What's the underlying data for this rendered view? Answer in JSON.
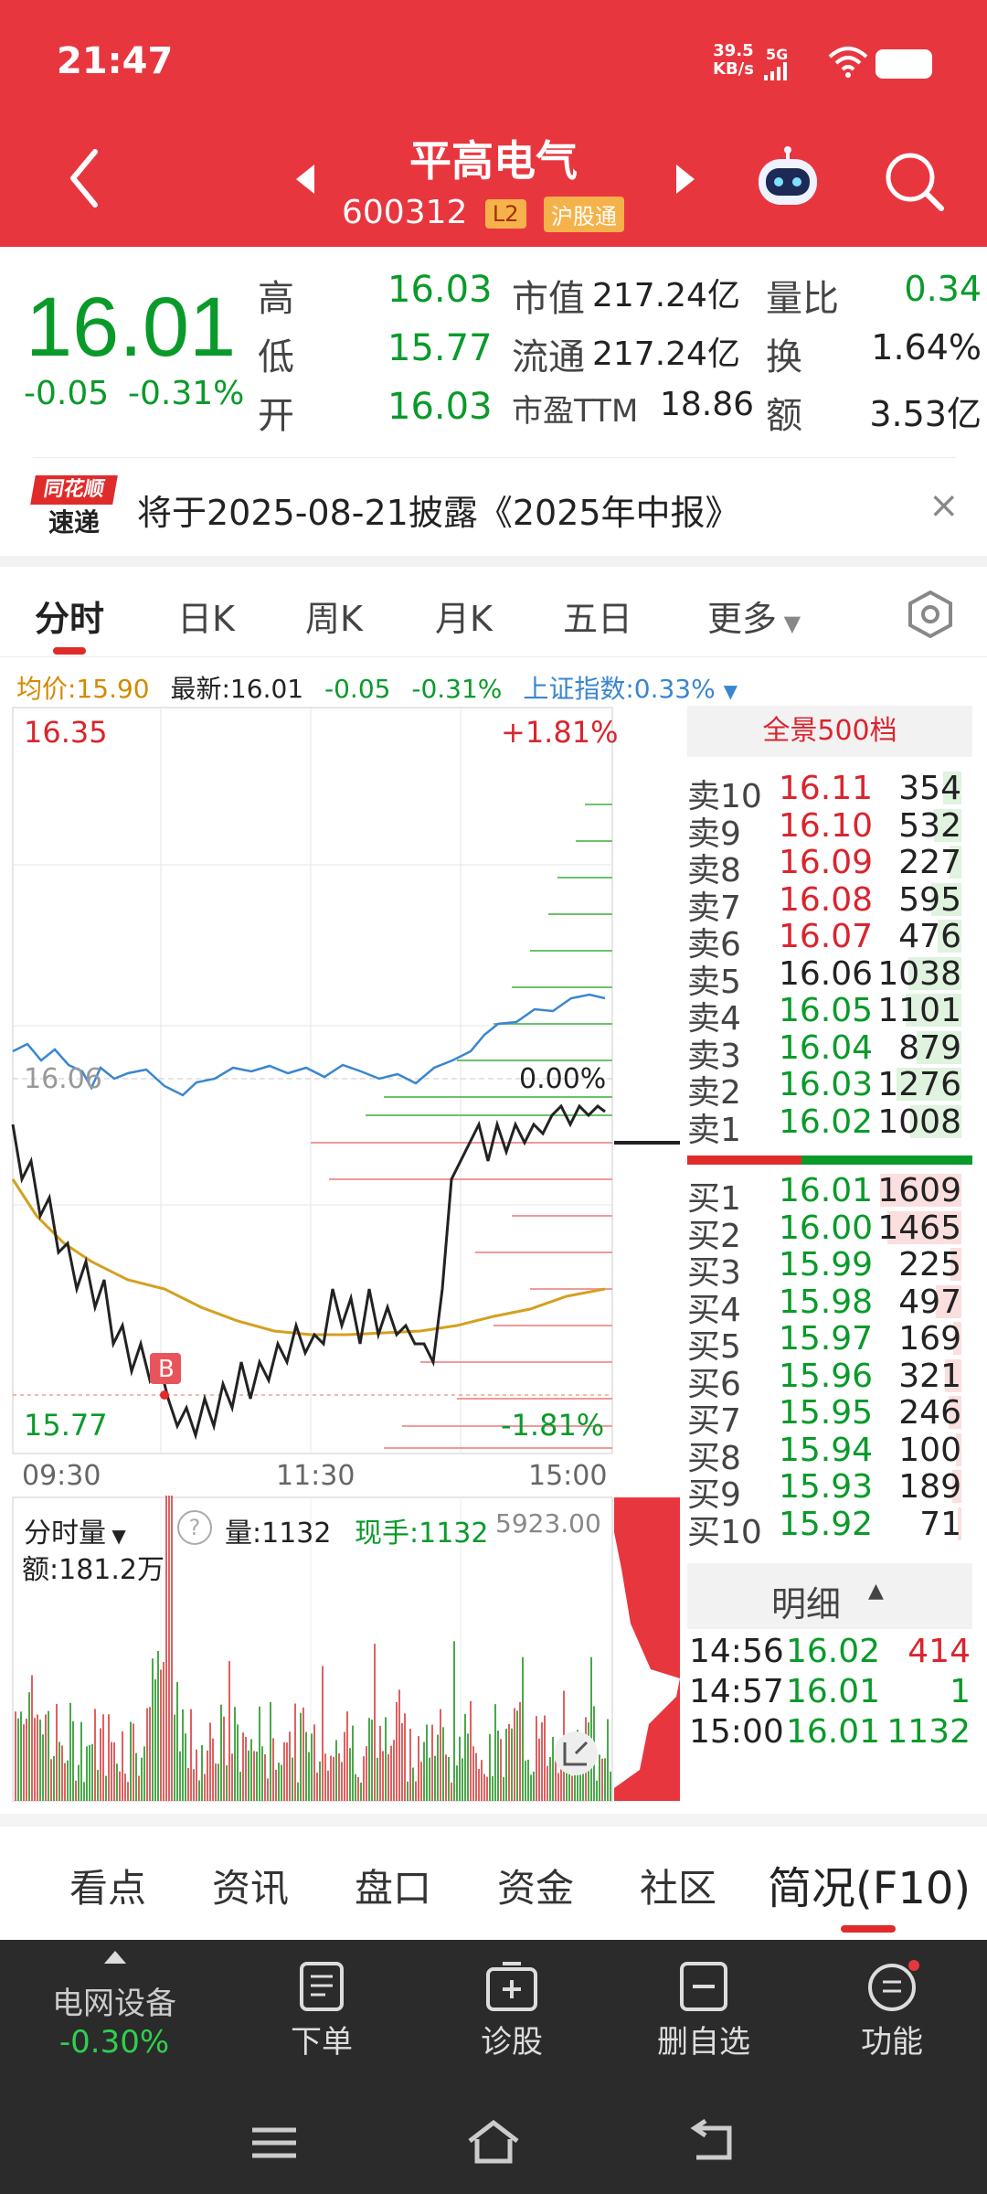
{
  "status_bar": {
    "time": "21:47",
    "net_speed": "39.5",
    "net_unit": "KB/s",
    "signal": "5G"
  },
  "header": {
    "name": "平高电气",
    "code": "600312",
    "tag_l2": "L2",
    "tag_connect": "沪股通"
  },
  "quote": {
    "price": "16.01",
    "change": "-0.05",
    "change_pct": "-0.31%",
    "high_label": "高",
    "high": "16.03",
    "low_label": "低",
    "low": "15.77",
    "open_label": "开",
    "open": "16.03",
    "mktcap_label": "市值",
    "mktcap": "217.24亿",
    "float_label": "流通",
    "float": "217.24亿",
    "pe_label": "市盈TTM",
    "pe": "18.86",
    "volratio_label": "量比",
    "volratio": "0.34",
    "turnover_label": "换",
    "turnover": "1.64%",
    "amount_label": "额",
    "amount": "3.53亿"
  },
  "notice": {
    "logo_top": "同花顺",
    "logo_bottom": "速递",
    "text": "将于2025-08-21披露《2025年中报》"
  },
  "chart_tabs": [
    "分时",
    "日K",
    "周K",
    "月K",
    "五日",
    "更多"
  ],
  "chart_info": {
    "avg": "均价:15.90",
    "latest": "最新:16.01",
    "chg": "-0.05",
    "pct": "-0.31%",
    "index": "上证指数:0.33%"
  },
  "chart_labels": {
    "top_price": "16.35",
    "top_pct": "+1.81%",
    "mid_price": "16.06",
    "mid_pct": "0.00%",
    "bot_price": "15.77",
    "bot_pct": "-1.81%",
    "t_start": "09:30",
    "t_mid": "11:30",
    "t_end": "15:00",
    "b_marker": "B"
  },
  "panorama_label": "全景500档",
  "asks": [
    {
      "n": "卖10",
      "p": "16.11",
      "v": "354"
    },
    {
      "n": "卖9",
      "p": "16.10",
      "v": "532"
    },
    {
      "n": "卖8",
      "p": "16.09",
      "v": "227"
    },
    {
      "n": "卖7",
      "p": "16.08",
      "v": "595"
    },
    {
      "n": "卖6",
      "p": "16.07",
      "v": "476"
    },
    {
      "n": "卖5",
      "p": "16.06",
      "v": "1038"
    },
    {
      "n": "卖4",
      "p": "16.05",
      "v": "1101"
    },
    {
      "n": "卖3",
      "p": "16.04",
      "v": "879"
    },
    {
      "n": "卖2",
      "p": "16.03",
      "v": "1276"
    },
    {
      "n": "卖1",
      "p": "16.02",
      "v": "1008"
    }
  ],
  "bids": [
    {
      "n": "买1",
      "p": "16.01",
      "v": "1609"
    },
    {
      "n": "买2",
      "p": "16.00",
      "v": "1465"
    },
    {
      "n": "买3",
      "p": "15.99",
      "v": "225"
    },
    {
      "n": "买4",
      "p": "15.98",
      "v": "497"
    },
    {
      "n": "买5",
      "p": "15.97",
      "v": "169"
    },
    {
      "n": "买6",
      "p": "15.96",
      "v": "321"
    },
    {
      "n": "买7",
      "p": "15.95",
      "v": "246"
    },
    {
      "n": "买8",
      "p": "15.94",
      "v": "100"
    },
    {
      "n": "买9",
      "p": "15.93",
      "v": "189"
    },
    {
      "n": "买10",
      "p": "15.92",
      "v": "71"
    }
  ],
  "detail": {
    "title": "明细",
    "rows": [
      {
        "t": "14:56",
        "p": "16.02",
        "v": "414"
      },
      {
        "t": "14:57",
        "p": "16.01",
        "v": "1"
      },
      {
        "t": "15:00",
        "p": "16.01",
        "v": "1132"
      }
    ]
  },
  "volume_panel": {
    "selector": "分时量",
    "vol": "量:1132",
    "cur": "现手:1132",
    "max": "5923.00",
    "amount": "额:181.2万"
  },
  "bottom_tabs": [
    "看点",
    "资讯",
    "盘口",
    "资金",
    "社区",
    "简况(F10)"
  ],
  "bottom_nav": {
    "sector_name": "电网设备",
    "sector_pct": "-0.30%",
    "order": "下单",
    "diagnose": "诊股",
    "remove": "删自选",
    "function": "功能"
  },
  "colors": {
    "header_red": "#e8363f",
    "up_red": "#d9252e",
    "down_green": "#0a9a2a",
    "index_blue": "#3a86d0",
    "avg_gold": "#d4a020"
  }
}
